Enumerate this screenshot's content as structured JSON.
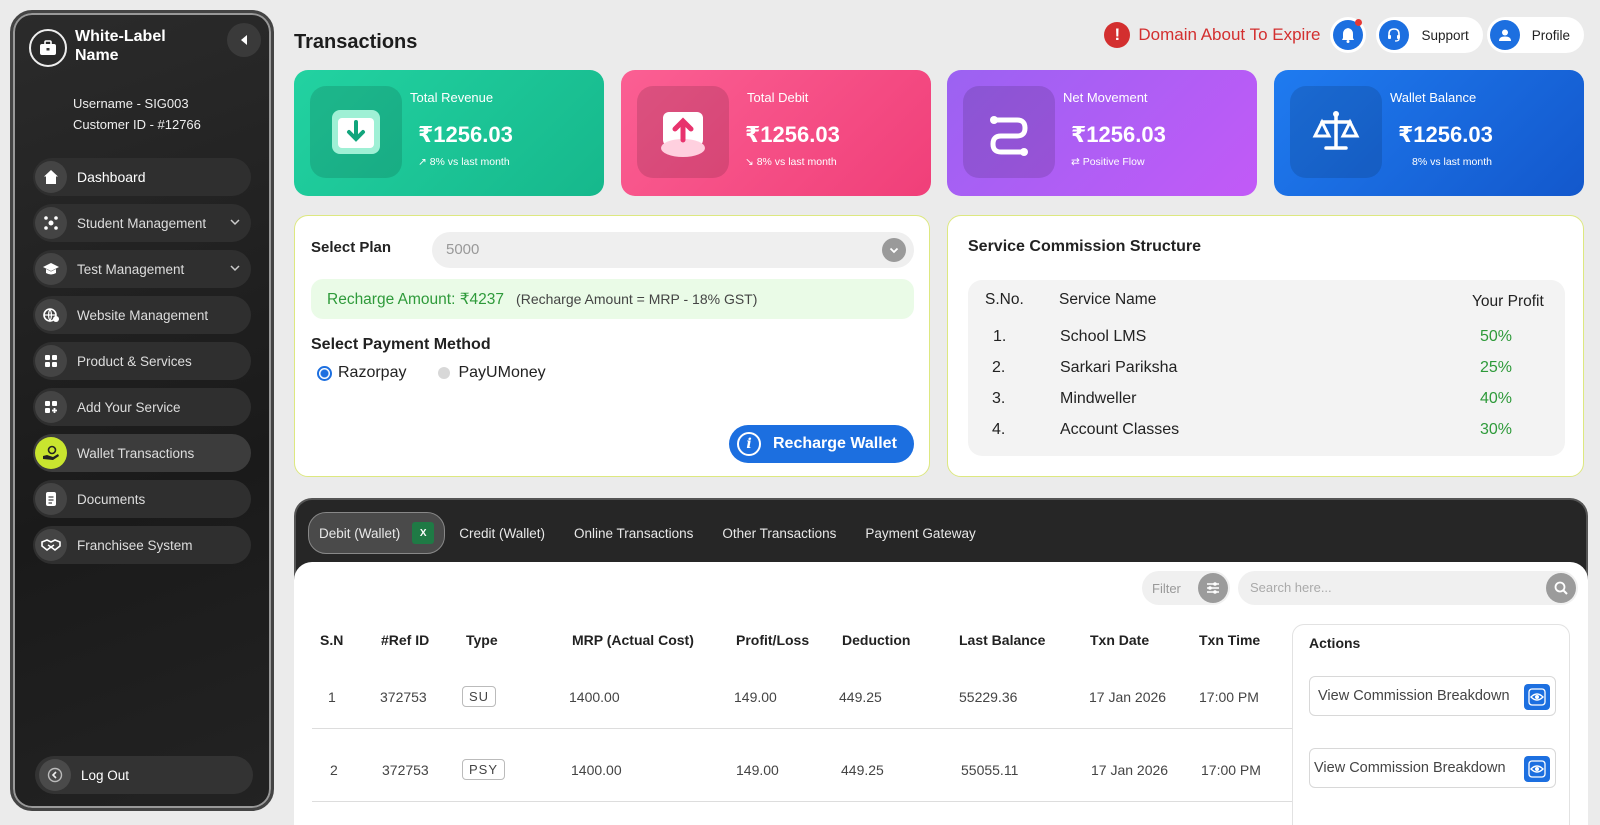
{
  "sidebar": {
    "brand_name": "White-Label Name",
    "username": "Username - SIG003",
    "customer_id": "Customer ID - #12766",
    "items": [
      {
        "label": "Dashboard"
      },
      {
        "label": "Student Management"
      },
      {
        "label": "Test Management"
      },
      {
        "label": "Website Management"
      },
      {
        "label": "Product & Services"
      },
      {
        "label": "Add Your Service"
      },
      {
        "label": "Wallet Transactions"
      },
      {
        "label": "Documents"
      },
      {
        "label": "Franchisee System"
      }
    ],
    "logout_label": "Log Out",
    "accent_color": "#c9e52f"
  },
  "header": {
    "title": "Transactions",
    "alert_text": "Domain About To Expire",
    "support_label": "Support",
    "profile_label": "Profile"
  },
  "cards": [
    {
      "label": "Total Revenue",
      "value": "₹1256.03",
      "sub": "↗ 8% vs last month",
      "icon": "download-box-icon",
      "color": "#1ec99a"
    },
    {
      "label": "Total Debit",
      "value": "₹1256.03",
      "sub": "↘ 8% vs last month",
      "icon": "upload-cloud-icon",
      "color": "#f74f86"
    },
    {
      "label": "Net Movement",
      "value": "₹1256.03",
      "sub": "⇄ Positive Flow",
      "icon": "route-icon",
      "color": "#b45df6"
    },
    {
      "label": "Wallet Balance",
      "value": "₹1256.03",
      "sub": "8% vs last month",
      "icon": "scale-icon",
      "color": "#1a6fe0"
    }
  ],
  "plan": {
    "select_label": "Select Plan",
    "selected_value": "5000",
    "recharge_amount": "Recharge Amount: ₹4237",
    "recharge_formula": "(Recharge Amount = MRP - 18% GST)",
    "payment_label": "Select Payment Method",
    "options": [
      "Razorpay",
      "PayUMoney"
    ],
    "selected_option": "Razorpay",
    "button_label": "Recharge Wallet"
  },
  "commission": {
    "title": "Service Commission Structure",
    "headers": [
      "S.No.",
      "Service Name",
      "Your Profit"
    ],
    "rows": [
      {
        "sno": "1.",
        "name": "School LMS",
        "profit": "50%"
      },
      {
        "sno": "2.",
        "name": "Sarkari Pariksha",
        "profit": "25%"
      },
      {
        "sno": "3.",
        "name": "Mindweller",
        "profit": "40%"
      },
      {
        "sno": "4.",
        "name": "Account Classes",
        "profit": "30%"
      }
    ]
  },
  "transactions": {
    "tabs": [
      "Debit (Wallet)",
      "Credit (Wallet)",
      "Online Transactions",
      "Other Transactions",
      "Payment Gateway"
    ],
    "active_tab": "Debit (Wallet)",
    "filter_placeholder": "Filter",
    "search_placeholder": "Search here...",
    "columns": [
      "S.N",
      "#Ref ID",
      "Type",
      "MRP (Actual Cost)",
      "Profit/Loss",
      "Deduction",
      "Last Balance",
      "Txn Date",
      "Txn Time",
      "Actions"
    ],
    "rows": [
      {
        "sn": "1",
        "ref": "372753",
        "type": "SU",
        "mrp": "1400.00",
        "profit": "149.00",
        "deduction": "449.25",
        "balance": "55229.36",
        "date": "17 Jan 2026",
        "time": "17:00 PM",
        "action": "View Commission Breakdown"
      },
      {
        "sn": "2",
        "ref": "372753",
        "type": "PSY",
        "mrp": "1400.00",
        "profit": "149.00",
        "deduction": "449.25",
        "balance": "55055.11",
        "date": "17 Jan 2026",
        "time": "17:00 PM",
        "action": "View Commission Breakdown"
      }
    ]
  }
}
